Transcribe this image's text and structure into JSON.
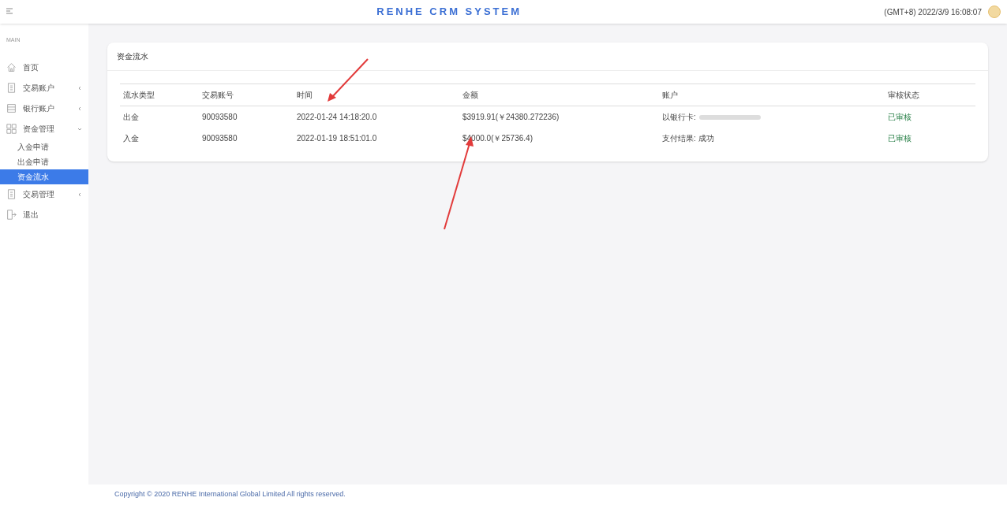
{
  "header": {
    "title": "RENHE CRM SYSTEM",
    "clock": "(GMT+8) 2022/3/9 16:08:07"
  },
  "sidebar": {
    "section": "MAIN",
    "items": [
      {
        "label": "首页"
      },
      {
        "label": "交易账户",
        "expanded": false
      },
      {
        "label": "银行账户",
        "expanded": false
      },
      {
        "label": "资金管理",
        "expanded": true,
        "children": [
          {
            "label": "入金申请",
            "selected": false
          },
          {
            "label": "出金申请",
            "selected": false
          },
          {
            "label": "资金流水",
            "selected": true
          }
        ]
      },
      {
        "label": "交易管理",
        "expanded": false
      },
      {
        "label": "退出"
      }
    ]
  },
  "card": {
    "title": "资金流水",
    "table": {
      "columns": [
        "流水类型",
        "交易账号",
        "时间",
        "金额",
        "账户",
        "审核状态"
      ],
      "rows": [
        {
          "cells": [
            "出金",
            "90093580",
            "2022-01-24 14:18:20.0",
            "$3919.91(￥24380.272236)",
            "以银行卡: ",
            "已审核"
          ],
          "account_redacted": true
        },
        {
          "cells": [
            "入金",
            "90093580",
            "2022-01-19 18:51:01.0",
            "$4000.0(￥25736.4)",
            "支付结果: 成功",
            "已审核"
          ]
        }
      ]
    }
  },
  "footer": {
    "copyright": "Copyright © 2020 RENHE International Global Limited All rights reserved."
  }
}
